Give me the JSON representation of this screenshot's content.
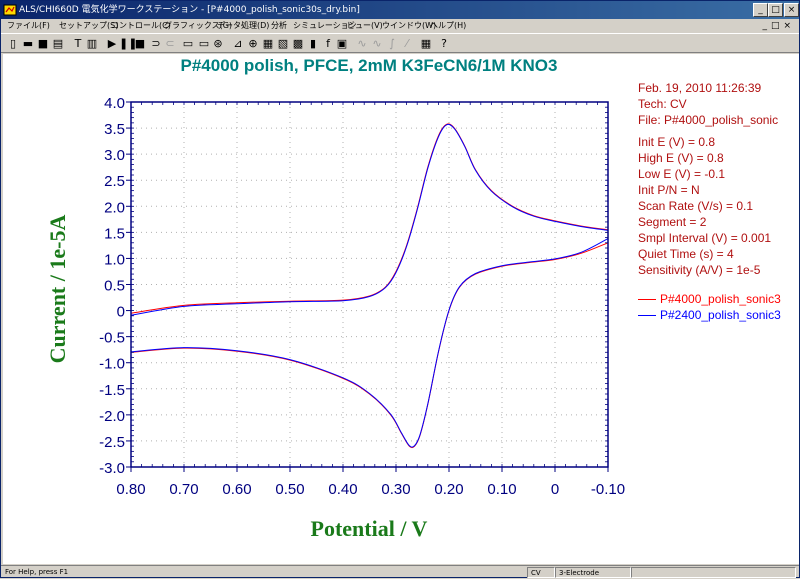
{
  "window": {
    "title": "ALS/CHI660D 電気化学ワークステーション - [P#4000_polish_sonic30s_dry.bin]"
  },
  "menus": [
    "ファイル(F)",
    "セットアップ(S)",
    "コントロール(C)",
    "グラフィックス(G)",
    "データ処理(D)",
    "分析",
    "シミュレーション",
    "ビュー(V)",
    "ウインドウ(W)",
    "ヘルプ(H)"
  ],
  "toolbar_icons": [
    "new-file-icon",
    "open-folder-icon",
    "save-disk-icon",
    "print-icon",
    "technique-icon",
    "parameters-icon",
    "run-icon",
    "pause-icon",
    "stop-icon",
    "reverse-scan-icon",
    "ir-comp-icon",
    "cell-icon",
    "graph-icon",
    "zoom-icon",
    "overlay-icon",
    "add-icon",
    "color-icon",
    "font-icon",
    "copy-icon",
    "info-icon",
    "smooth-icon",
    "derivative-icon",
    "integrate-icon",
    "baseline-icon",
    "calc-icon",
    "help-icon"
  ],
  "chart_data": {
    "type": "line",
    "title": "P#4000 polish, PFCE, 2mM K3FeCN6/1M KNO3",
    "xlabel": "Potential / V",
    "ylabel": "Current / 1e-5A",
    "xlim": [
      0.8,
      -0.1
    ],
    "ylim": [
      -3.0,
      4.0
    ],
    "x_reversed": true,
    "xticks": [
      "0.80",
      "0.70",
      "0.60",
      "0.50",
      "0.40",
      "0.30",
      "0.20",
      "0.10",
      "0",
      "-0.10"
    ],
    "yticks": [
      "4.0",
      "3.5",
      "3.0",
      "2.5",
      "2.0",
      "1.5",
      "1.0",
      "0.5",
      "0",
      "-0.5",
      "-1.0",
      "-1.5",
      "-2.0",
      "-2.5",
      "-3.0"
    ],
    "grid": true,
    "legend_position": "right",
    "series": [
      {
        "name": "P#4000_polish_sonic3",
        "color": "#ff0000",
        "forward": {
          "x": [
            0.8,
            0.7,
            0.6,
            0.5,
            0.4,
            0.35,
            0.32,
            0.3,
            0.28,
            0.26,
            0.24,
            0.22,
            0.205,
            0.19,
            0.17,
            0.15,
            0.12,
            0.08,
            0.04,
            0.0,
            -0.05,
            -0.1
          ],
          "y": [
            -0.05,
            0.1,
            0.15,
            0.18,
            0.2,
            0.28,
            0.45,
            0.75,
            1.25,
            1.95,
            2.75,
            3.35,
            3.57,
            3.5,
            3.15,
            2.7,
            2.3,
            2.0,
            1.82,
            1.72,
            1.62,
            1.55
          ]
        },
        "reverse": {
          "x": [
            -0.1,
            -0.05,
            0.0,
            0.05,
            0.1,
            0.15,
            0.18,
            0.2,
            0.22,
            0.24,
            0.255,
            0.265,
            0.275,
            0.29,
            0.31,
            0.35,
            0.4,
            0.5,
            0.6,
            0.7,
            0.8
          ],
          "y": [
            1.3,
            1.1,
            0.98,
            0.92,
            0.85,
            0.7,
            0.45,
            0.0,
            -0.8,
            -1.8,
            -2.4,
            -2.6,
            -2.6,
            -2.35,
            -2.0,
            -1.6,
            -1.3,
            -0.95,
            -0.78,
            -0.72,
            -0.8
          ]
        }
      },
      {
        "name": "P#2400_polish_sonic3",
        "color": "#0000ff",
        "forward": {
          "x": [
            0.8,
            0.7,
            0.6,
            0.5,
            0.4,
            0.35,
            0.32,
            0.3,
            0.28,
            0.26,
            0.24,
            0.22,
            0.205,
            0.19,
            0.17,
            0.15,
            0.12,
            0.08,
            0.04,
            0.0,
            -0.05,
            -0.1
          ],
          "y": [
            -0.09,
            0.08,
            0.13,
            0.17,
            0.19,
            0.27,
            0.44,
            0.73,
            1.23,
            1.93,
            2.73,
            3.33,
            3.56,
            3.49,
            3.14,
            2.69,
            2.29,
            1.99,
            1.81,
            1.71,
            1.61,
            1.54
          ]
        },
        "reverse": {
          "x": [
            -0.1,
            -0.05,
            0.0,
            0.05,
            0.1,
            0.15,
            0.18,
            0.2,
            0.22,
            0.24,
            0.255,
            0.265,
            0.275,
            0.29,
            0.31,
            0.35,
            0.4,
            0.5,
            0.6,
            0.7,
            0.8
          ],
          "y": [
            1.38,
            1.12,
            0.99,
            0.93,
            0.86,
            0.71,
            0.46,
            0.01,
            -0.79,
            -1.79,
            -2.39,
            -2.59,
            -2.59,
            -2.34,
            -1.99,
            -1.59,
            -1.29,
            -0.94,
            -0.77,
            -0.71,
            -0.79
          ]
        }
      }
    ]
  },
  "info": {
    "datetime": "Feb. 19, 2010    11:26:39",
    "tech": "Tech: CV",
    "file": "File: P#4000_polish_sonic",
    "params": [
      "Init E (V) = 0.8",
      "High E (V) = 0.8",
      "Low E (V) = -0.1",
      "Init P/N = N",
      "Scan Rate (V/s) = 0.1",
      "Segment = 2",
      "Smpl Interval (V) = 0.001",
      "Quiet Time (s) = 4",
      "Sensitivity (A/V) = 1e-5"
    ]
  },
  "statusbar": {
    "help": "For Help, press F1",
    "technique": "CV",
    "electrode": "3-Electrode"
  },
  "colors": {
    "axis": "#000080",
    "label_green": "#1a7a1a",
    "title_teal": "#008080",
    "info_red": "#b01010"
  }
}
